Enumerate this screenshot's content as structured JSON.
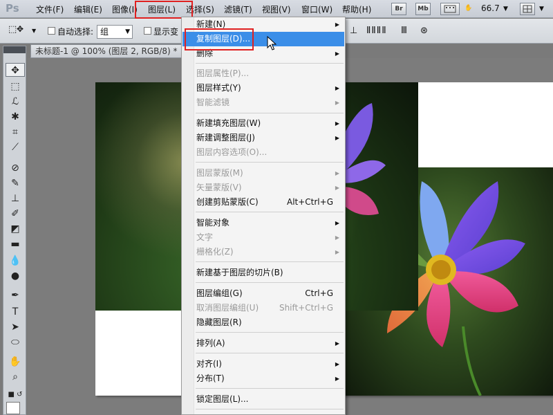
{
  "menubar": {
    "logo": "Ps",
    "items": [
      "文件(F)",
      "编辑(E)",
      "图像(I)",
      "图层(L)",
      "选择(S)",
      "滤镜(T)",
      "视图(V)",
      "窗口(W)",
      "帮助(H)"
    ],
    "bridge_label": "Br",
    "minibridge_label": "Mb",
    "zoom_value": "66.7"
  },
  "options": {
    "auto_select_label": "自动选择:",
    "auto_select_value": "组",
    "show_transform_label": "显示变"
  },
  "document": {
    "tab_title": "未标题-1 @ 100% (图层 2, RGB/8) *"
  },
  "layer_menu": {
    "items": [
      {
        "label": "新建(N)",
        "shortcut": "",
        "submenu": true,
        "disabled": false
      },
      {
        "label": "复制图层(D)...",
        "shortcut": "",
        "submenu": false,
        "disabled": false,
        "highlighted": true
      },
      {
        "label": "删除",
        "shortcut": "",
        "submenu": true,
        "disabled": false
      },
      {
        "label": "图层属性(P)...",
        "shortcut": "",
        "submenu": false,
        "disabled": true
      },
      {
        "label": "图层样式(Y)",
        "shortcut": "",
        "submenu": true,
        "disabled": false
      },
      {
        "label": "智能滤镜",
        "shortcut": "",
        "submenu": true,
        "disabled": true
      },
      {
        "label": "新建填充图层(W)",
        "shortcut": "",
        "submenu": true,
        "disabled": false
      },
      {
        "label": "新建调整图层(J)",
        "shortcut": "",
        "submenu": true,
        "disabled": false
      },
      {
        "label": "图层内容选项(O)...",
        "shortcut": "",
        "submenu": false,
        "disabled": true
      },
      {
        "label": "图层蒙版(M)",
        "shortcut": "",
        "submenu": true,
        "disabled": true
      },
      {
        "label": "矢量蒙版(V)",
        "shortcut": "",
        "submenu": true,
        "disabled": true
      },
      {
        "label": "创建剪贴蒙版(C)",
        "shortcut": "Alt+Ctrl+G",
        "submenu": false,
        "disabled": false
      },
      {
        "label": "智能对象",
        "shortcut": "",
        "submenu": true,
        "disabled": false
      },
      {
        "label": "文字",
        "shortcut": "",
        "submenu": true,
        "disabled": true
      },
      {
        "label": "栅格化(Z)",
        "shortcut": "",
        "submenu": true,
        "disabled": true
      },
      {
        "label": "新建基于图层的切片(B)",
        "shortcut": "",
        "submenu": false,
        "disabled": false
      },
      {
        "label": "图层编组(G)",
        "shortcut": "Ctrl+G",
        "submenu": false,
        "disabled": false
      },
      {
        "label": "取消图层编组(U)",
        "shortcut": "Shift+Ctrl+G",
        "submenu": false,
        "disabled": true
      },
      {
        "label": "隐藏图层(R)",
        "shortcut": "",
        "submenu": false,
        "disabled": false
      },
      {
        "label": "排列(A)",
        "shortcut": "",
        "submenu": true,
        "disabled": false
      },
      {
        "label": "对齐(I)",
        "shortcut": "",
        "submenu": true,
        "disabled": false
      },
      {
        "label": "分布(T)",
        "shortcut": "",
        "submenu": true,
        "disabled": false
      },
      {
        "label": "锁定图层(L)...",
        "shortcut": "",
        "submenu": false,
        "disabled": false
      }
    ]
  },
  "colors": {
    "highlight": "#3b8ee8",
    "callout": "#e02020"
  }
}
